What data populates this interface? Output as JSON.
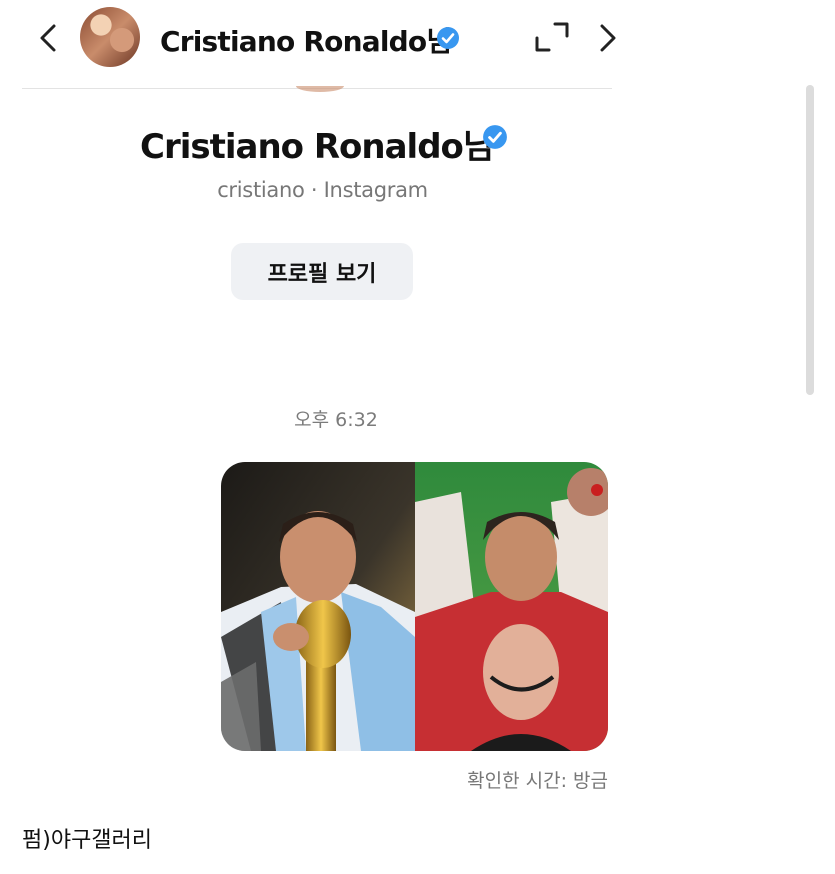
{
  "header": {
    "name": "Cristiano Ronaldo님",
    "back_icon": "chevron-left-icon",
    "expand_icon": "expand-icon",
    "next_icon": "chevron-right-icon",
    "verified_color": "#3897f0"
  },
  "profile": {
    "name": "Cristiano Ronaldo님",
    "subtitle": "cristiano · Instagram",
    "view_profile_label": "프로필 보기"
  },
  "chat": {
    "timestamp": "오후 6:32",
    "read_receipt": "확인한 시간: 방금"
  },
  "footer": {
    "source": "펌)야구갤러리"
  }
}
